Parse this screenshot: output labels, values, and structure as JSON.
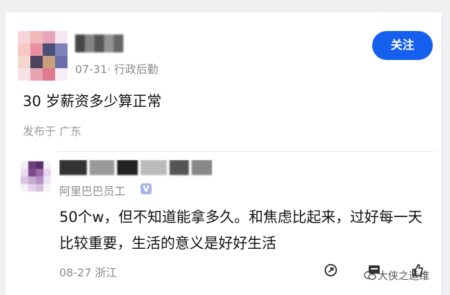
{
  "post": {
    "author_meta": "07-31· 行政后勤",
    "follow_label": "关注",
    "title": "30 岁薪资多少算正常",
    "location": "发布于 广东"
  },
  "comment": {
    "role": "阿里巴巴员工",
    "verified_mark": "V",
    "text": "50个w，但不知道能拿多久。和焦虑比起来，过好每一天比较重要，生活的意义是好好生活",
    "date": "08-27 浙江"
  },
  "watermark": {
    "text": "大侠之运维"
  },
  "colors": {
    "accent": "#1660f0",
    "meta_gray": "#8a8a8a",
    "verified_badge": "#a7b7ea"
  }
}
